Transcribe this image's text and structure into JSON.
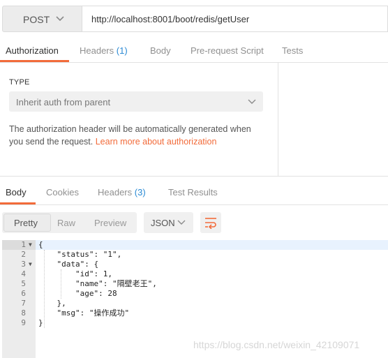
{
  "request": {
    "method": "POST",
    "url": "http://localhost:8001/boot/redis/getUser"
  },
  "request_tabs": [
    {
      "label": "Authorization",
      "count": ""
    },
    {
      "label": "Headers",
      "count": "(1)"
    },
    {
      "label": "Body",
      "count": ""
    },
    {
      "label": "Pre-request Script",
      "count": ""
    },
    {
      "label": "Tests",
      "count": ""
    }
  ],
  "auth": {
    "type_label": "TYPE",
    "type_value": "Inherit auth from parent",
    "description": "The authorization header will be automatically generated when you send the request.",
    "link_text": "Learn more about authorization"
  },
  "response_tabs": [
    {
      "label": "Body",
      "count": ""
    },
    {
      "label": "Cookies",
      "count": ""
    },
    {
      "label": "Headers",
      "count": "(3)"
    },
    {
      "label": "Test Results",
      "count": ""
    }
  ],
  "view_modes": [
    "Pretty",
    "Raw",
    "Preview"
  ],
  "format": "JSON",
  "code_lines": [
    {
      "num": "1",
      "text": "{"
    },
    {
      "num": "2",
      "text": "    \"status\": \"1\","
    },
    {
      "num": "3",
      "text": "    \"data\": {"
    },
    {
      "num": "4",
      "text": "        \"id\": 1,"
    },
    {
      "num": "5",
      "text": "        \"name\": \"隔壁老王\","
    },
    {
      "num": "6",
      "text": "        \"age\": 28"
    },
    {
      "num": "7",
      "text": "    },"
    },
    {
      "num": "8",
      "text": "    \"msg\": \"操作成功\""
    },
    {
      "num": "9",
      "text": "}"
    }
  ],
  "watermark": "https://blog.csdn.net/weixin_42109071",
  "colors": {
    "accent": "#f26b3a",
    "count": "#2a8ad4"
  }
}
